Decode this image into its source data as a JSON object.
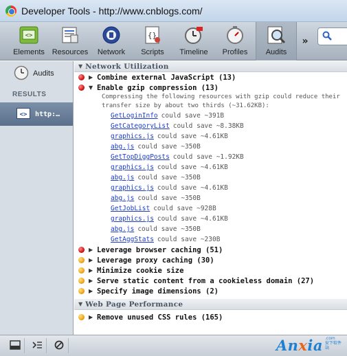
{
  "window": {
    "title": "Developer Tools - http://www.cnblogs.com/"
  },
  "toolbar": {
    "items": [
      {
        "label": "Elements",
        "icon": "elements-icon"
      },
      {
        "label": "Resources",
        "icon": "resources-icon"
      },
      {
        "label": "Network",
        "icon": "network-icon"
      },
      {
        "label": "Scripts",
        "icon": "scripts-icon"
      },
      {
        "label": "Timeline",
        "icon": "timeline-icon"
      },
      {
        "label": "Profiles",
        "icon": "profiles-icon"
      },
      {
        "label": "Audits",
        "icon": "audits-icon",
        "selected": true
      }
    ],
    "more": "»",
    "search_icon": "search-icon"
  },
  "sidebar": {
    "audits_label": "Audits",
    "results_header": "RESULTS",
    "result_item": "http:…"
  },
  "main": {
    "network_section": {
      "title": "Network Utilization",
      "rule_combine": "Combine external JavaScript (13)",
      "rule_gzip": "Enable gzip compression (13)",
      "gzip_description": "Compressing the following resources with gzip could reduce their transfer size by about two thirds (~31.62KB):",
      "gzip_resources": [
        {
          "name": "GetLoginInfo",
          "saving": "could save ~391B"
        },
        {
          "name": "GetCategoryList",
          "saving": "could save ~8.38KB"
        },
        {
          "name": "graphics.js",
          "saving": "could save ~4.61KB"
        },
        {
          "name": "abg.js",
          "saving": "could save ~350B"
        },
        {
          "name": "GetTopDiggPosts",
          "saving": "could save ~1.92KB"
        },
        {
          "name": "graphics.js",
          "saving": "could save ~4.61KB"
        },
        {
          "name": "abg.js",
          "saving": "could save ~350B"
        },
        {
          "name": "graphics.js",
          "saving": "could save ~4.61KB"
        },
        {
          "name": "abg.js",
          "saving": "could save ~350B"
        },
        {
          "name": "GetJobList",
          "saving": "could save ~928B"
        },
        {
          "name": "graphics.js",
          "saving": "could save ~4.61KB"
        },
        {
          "name": "abg.js",
          "saving": "could save ~350B"
        },
        {
          "name": "GetAggStats",
          "saving": "could save ~230B"
        }
      ],
      "rule_browser_caching": "Leverage browser caching (51)",
      "rule_proxy_caching": "Leverage proxy caching (30)",
      "rule_cookie": "Minimize cookie size",
      "rule_static": "Serve static content from a cookieless domain (27)",
      "rule_dimensions": "Specify image dimensions (2)"
    },
    "performance_section": {
      "title": "Web Page Performance",
      "rule_unused_css": "Remove unused CSS rules (165)"
    }
  },
  "statusbar": {
    "brand": "Anxia",
    "brand_x": "x",
    "brand_pre": "An",
    "brand_post": "ia",
    "brand_dot": ".com",
    "brand_sub": "安下软件站"
  },
  "colors": {
    "severe": "#d11515",
    "warning": "#f2a516",
    "link": "#1a3cc7",
    "selected_sidebar": "#5b708c"
  }
}
